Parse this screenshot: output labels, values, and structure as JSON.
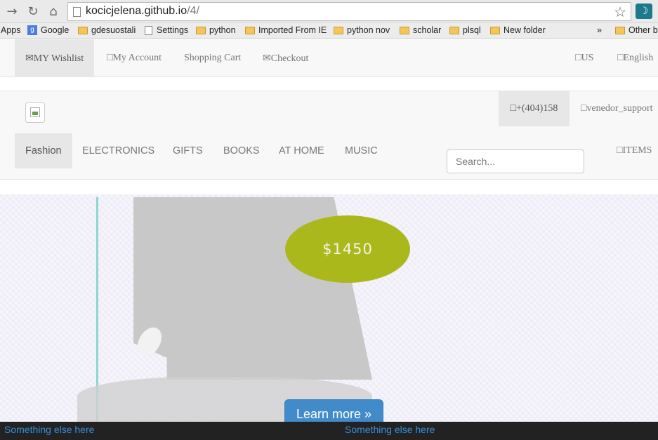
{
  "browser": {
    "url_host": "kocicjelena.github.io",
    "url_path": "/4/",
    "bookmarks": [
      {
        "label": "Apps",
        "icon": "apps-icon"
      },
      {
        "label": "Google",
        "icon": "google-icon"
      },
      {
        "label": "gdesuostali",
        "icon": "folder-icon"
      },
      {
        "label": "Settings",
        "icon": "page-icon"
      },
      {
        "label": "python",
        "icon": "folder-icon"
      },
      {
        "label": "Imported From IE",
        "icon": "folder-icon"
      },
      {
        "label": "python nov",
        "icon": "folder-icon"
      },
      {
        "label": "scholar",
        "icon": "folder-icon"
      },
      {
        "label": "plsql",
        "icon": "folder-icon"
      },
      {
        "label": "New folder",
        "icon": "folder-icon"
      }
    ],
    "overflow": "»",
    "other_bookmarks": "Other b"
  },
  "top_bar": {
    "wishlist": "✉MY Wishlist",
    "account": "□My Account",
    "cart": "Shopping Cart",
    "checkout": "✉Checkout",
    "region": "□US",
    "language": "□English"
  },
  "header": {
    "phone": "□+(404)158",
    "support": "□venedor_support"
  },
  "categories": [
    "Fashion",
    "ELECTRONICS",
    "GIFTS",
    "BOOKS",
    "AT HOME",
    "MUSIC"
  ],
  "search": {
    "placeholder": "Search..."
  },
  "items_link": "□ITEMS",
  "hero": {
    "price": "$1450",
    "cta": "Learn more »"
  },
  "footer": {
    "link_left": "Something else here",
    "link_right": "Something else here"
  },
  "colors": {
    "price_badge": "#abb81c",
    "cta": "#428bca",
    "footer_bg": "#222222",
    "footer_link": "#3a8fd9"
  }
}
